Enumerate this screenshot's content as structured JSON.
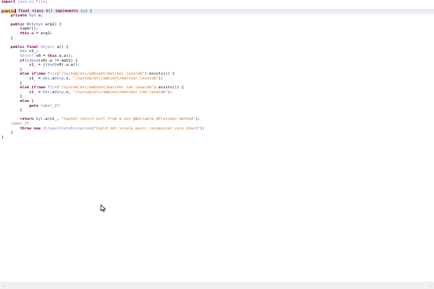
{
  "code": {
    "import_kw": "import",
    "import_path": "java.io.File",
    "semi": ";",
    "public_kw": "public",
    "final_kw": "final",
    "class_kw": "class",
    "class_name": "bll",
    "implements_kw": "implements",
    "iface": "byn",
    "open_brace": "{",
    "close_brace": "}",
    "private_kw": "private",
    "field_type": "byn",
    "field_decl": " a;",
    "ctor_name": "bll(",
    "ctor_param_type": "byn",
    "ctor_param": " arg1) {",
    "super_call": "super();",
    "this_kw": "this",
    "assign_field": ".a = arg1;",
    "object_type": "Object",
    "method_sig": " a() {",
    "bkx_type": "bkx",
    "v1_decl": " v1_;",
    "v0_decl_a": " v0 = ",
    "v0_decl_b": ".a.a();",
    "if_kw": "if",
    "if_cond_a": "(((",
    "bod_type": "bod",
    "if_cond_b": ")v0).a != ",
    "null_kw": "null",
    "if_cond_c": ") {",
    "assign_v1_a": "v1_ = ((",
    "assign_v1_b": ")v0).a.a();",
    "else_kw": "else",
    "new_kw": "new",
    "file_type": "File",
    "path1": "\"/system/etc/ambient/matcher.leveldb\"",
    "path2": "\"/system/etc/ambient/matcher_tah.leveldb\"",
    "exists_call": ").exists()) {",
    "v1_assign_a": "v1_ = ",
    "bkx_call": ".a(",
    "blp_type": "blp",
    "field_o": ".o, ",
    "call_end": ");",
    "paren_open": "(",
    "goto_kw": "goto",
    "label_ref": "label_27;",
    "return_kw": "return",
    "byl_type": "byl",
    "return_call_a": ".a(v1_, ",
    "return_msg": "\"Cannot return null from a non-@Nullable @Provides method\"",
    "label_def": "label_27:",
    "throw_kw": "throw",
    "exception_type": "IllegalStateException",
    "throw_msg": "\"Could not locate music recognizer core shard\""
  },
  "scrollbar": {
    "left_arrow": "‹",
    "right_arrow": "›"
  }
}
